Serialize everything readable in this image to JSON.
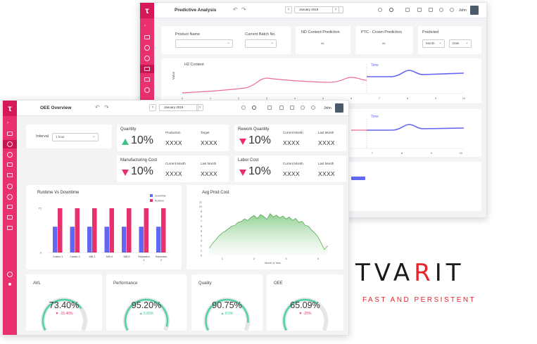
{
  "back": {
    "title": "Predictive Analysis",
    "date": "January 2019",
    "user": "John",
    "filters": {
      "product_name": "Product Name",
      "current_batch": "Current Batch No.",
      "nd_content": "ND Content Prediction",
      "nd_value": "xx",
      "ptc": "PTC - Crown Prediction",
      "ptc_value": "xx",
      "predicted": "Predicted",
      "month": "Month",
      "date_sel": "Date"
    },
    "chart1": {
      "title": "H2 Content",
      "ylabel": "Value",
      "time_label": "Time",
      "xticks": [
        "0",
        "1",
        "2",
        "3",
        "4",
        "5",
        "6",
        "7",
        "8",
        "9",
        "10"
      ]
    },
    "chart2": {
      "time_label": "Time",
      "xticks": [
        "7",
        "8",
        "9",
        "10"
      ]
    }
  },
  "front": {
    "title": "OEE Overview",
    "date": "January 2019",
    "user": "John",
    "interval_label": "Interval",
    "interval_value": "1 hour",
    "kpis": [
      {
        "title": "Quantity",
        "value": "10%",
        "trend": "up",
        "c1": "Production",
        "c2": "Target",
        "v1": "XXXX",
        "v2": "XXXX"
      },
      {
        "title": "Rework Quantity",
        "value": "10%",
        "trend": "down",
        "c1": "Current Month",
        "c2": "Last Month",
        "v1": "XXXX",
        "v2": "XXXX"
      },
      {
        "title": "Manufacturing Cost",
        "value": "10%",
        "trend": "down",
        "c1": "Current Month",
        "c2": "Last Month",
        "v1": "XXXX",
        "v2": "XXXX"
      },
      {
        "title": "Labor Cost",
        "value": "10%",
        "trend": "down",
        "c1": "Current Month",
        "c2": "Last Month",
        "v1": "XXXX",
        "v2": "XXXX"
      }
    ],
    "gauges": [
      {
        "title": "AVL",
        "value": "73.40%",
        "delta": "▼ -15.40%",
        "trend": "down",
        "fill": 0.734
      },
      {
        "title": "Performance",
        "value": "95.20%",
        "delta": "▲ 5.65%",
        "trend": "up",
        "fill": 0.952
      },
      {
        "title": "Quality",
        "value": "90.75%",
        "delta": "▲ 8.5%",
        "trend": "up",
        "fill": 0.9075
      },
      {
        "title": "OEE",
        "value": "65.09%",
        "delta": "▼ -25%",
        "trend": "down",
        "fill": 0.6509
      }
    ]
  },
  "brand": {
    "name_a": "TVA",
    "name_b": "R",
    "name_c": "IT",
    "tagline": "FAST AND PERSISTENT"
  },
  "colors": {
    "pink": "#e8306c",
    "blue": "#6366f1",
    "green": "#3ec48a",
    "gauge_track": "#e6e6e6"
  },
  "chart_data": [
    {
      "type": "bar",
      "title": "Runtime Vs Downtime",
      "categories": [
        "Castor-1",
        "Castor-2",
        "Mill-1",
        "Mill-4",
        "Mill-5",
        "Separator 1",
        "Separator 2"
      ],
      "series": [
        {
          "name": "Downtime",
          "values": [
            42,
            42,
            42,
            42,
            42,
            42,
            42
          ]
        },
        {
          "name": "Runtime",
          "values": [
            72,
            72,
            72,
            72,
            72,
            72,
            72
          ]
        }
      ],
      "yticks": [
        "0",
        "72"
      ],
      "ylim": [
        0,
        80
      ]
    },
    {
      "type": "area",
      "title": "Avg Prod Cost",
      "xlabel": "Month & Year",
      "xticks": [
        "1",
        "2",
        "3",
        "4"
      ],
      "yticks": [
        "0",
        "1",
        "2",
        "3",
        "4",
        "5",
        "6",
        "7",
        "8",
        "9",
        "10",
        "11"
      ],
      "ylim": [
        0,
        11
      ],
      "x": [
        0.6,
        0.7,
        0.8,
        0.9,
        1.0,
        1.1,
        1.2,
        1.3,
        1.4,
        1.5,
        1.6,
        1.7,
        1.8,
        1.9,
        2.0,
        2.1,
        2.2,
        2.3,
        2.4,
        2.5,
        2.6,
        2.7,
        2.8,
        2.9,
        3.0,
        3.1,
        3.2,
        3.3,
        3.4,
        3.5,
        3.6,
        3.7,
        3.8,
        3.9,
        4.0,
        4.1,
        4.2,
        4.3
      ],
      "y": [
        1.5,
        2.5,
        3.2,
        4.0,
        4.6,
        5.0,
        5.5,
        6.0,
        6.2,
        6.8,
        7.0,
        7.5,
        7.2,
        7.8,
        8.2,
        7.6,
        8.4,
        8.0,
        7.4,
        8.6,
        7.9,
        8.3,
        7.7,
        8.1,
        7.5,
        7.9,
        7.2,
        7.6,
        6.8,
        7.0,
        6.2,
        6.0,
        5.2,
        4.6,
        3.8,
        2.5,
        1.2,
        2.0
      ]
    }
  ]
}
